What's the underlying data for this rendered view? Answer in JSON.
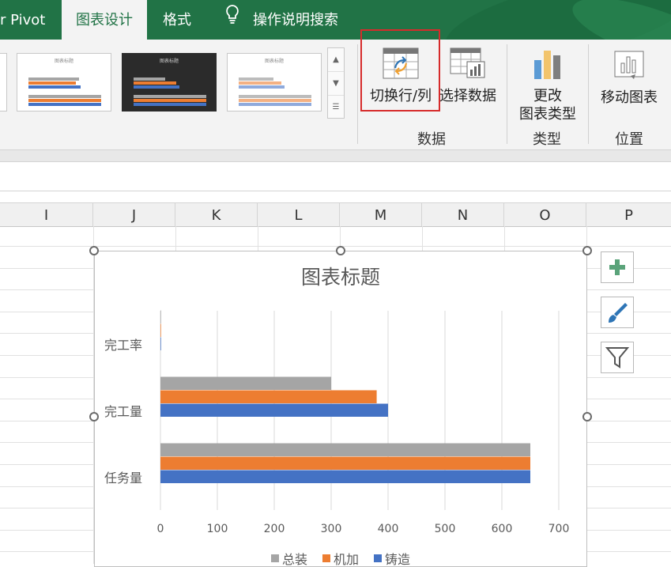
{
  "ribbon": {
    "tabs": [
      {
        "label": "r Pivot"
      },
      {
        "label": "图表设计"
      },
      {
        "label": "格式"
      },
      {
        "label": "操作说明搜索"
      }
    ],
    "gallery": {
      "thumbs": [
        {
          "title": "图表标题"
        },
        {
          "title": "图表标题"
        },
        {
          "title": "图表标题"
        }
      ]
    },
    "buttons": {
      "switch_row_col": "切换行/列",
      "select_data": "选择数据",
      "change_type_line1": "更改",
      "change_type_line2": "图表类型",
      "move_chart": "移动图表"
    },
    "groups": {
      "data": "数据",
      "type": "类型",
      "location": "位置"
    }
  },
  "sheet": {
    "columns": [
      "I",
      "J",
      "K",
      "L",
      "M",
      "N",
      "O",
      "P"
    ]
  },
  "colors": {
    "series_zongzhuang": "#a5a5a5",
    "series_jijia": "#ed7d31",
    "series_zhuzao": "#4472c4",
    "excel_green": "#217346",
    "highlight": "#d62b2b"
  },
  "side_buttons": [
    "plus-icon",
    "brush-icon",
    "filter-icon"
  ],
  "chart_data": {
    "type": "bar",
    "orientation": "horizontal",
    "title": "图表标题",
    "categories": [
      "任务量",
      "完工量",
      "完工率"
    ],
    "series": [
      {
        "name": "铸造",
        "values": [
          650,
          400,
          1
        ]
      },
      {
        "name": "机加",
        "values": [
          650,
          380,
          1
        ]
      },
      {
        "name": "总装",
        "values": [
          650,
          300,
          1
        ]
      }
    ],
    "xlim": [
      0,
      700
    ],
    "xticks": [
      0,
      100,
      200,
      300,
      400,
      500,
      600,
      700
    ],
    "grid": true,
    "legend": "bottom",
    "legend_order": [
      "总装",
      "机加",
      "铸造"
    ]
  }
}
